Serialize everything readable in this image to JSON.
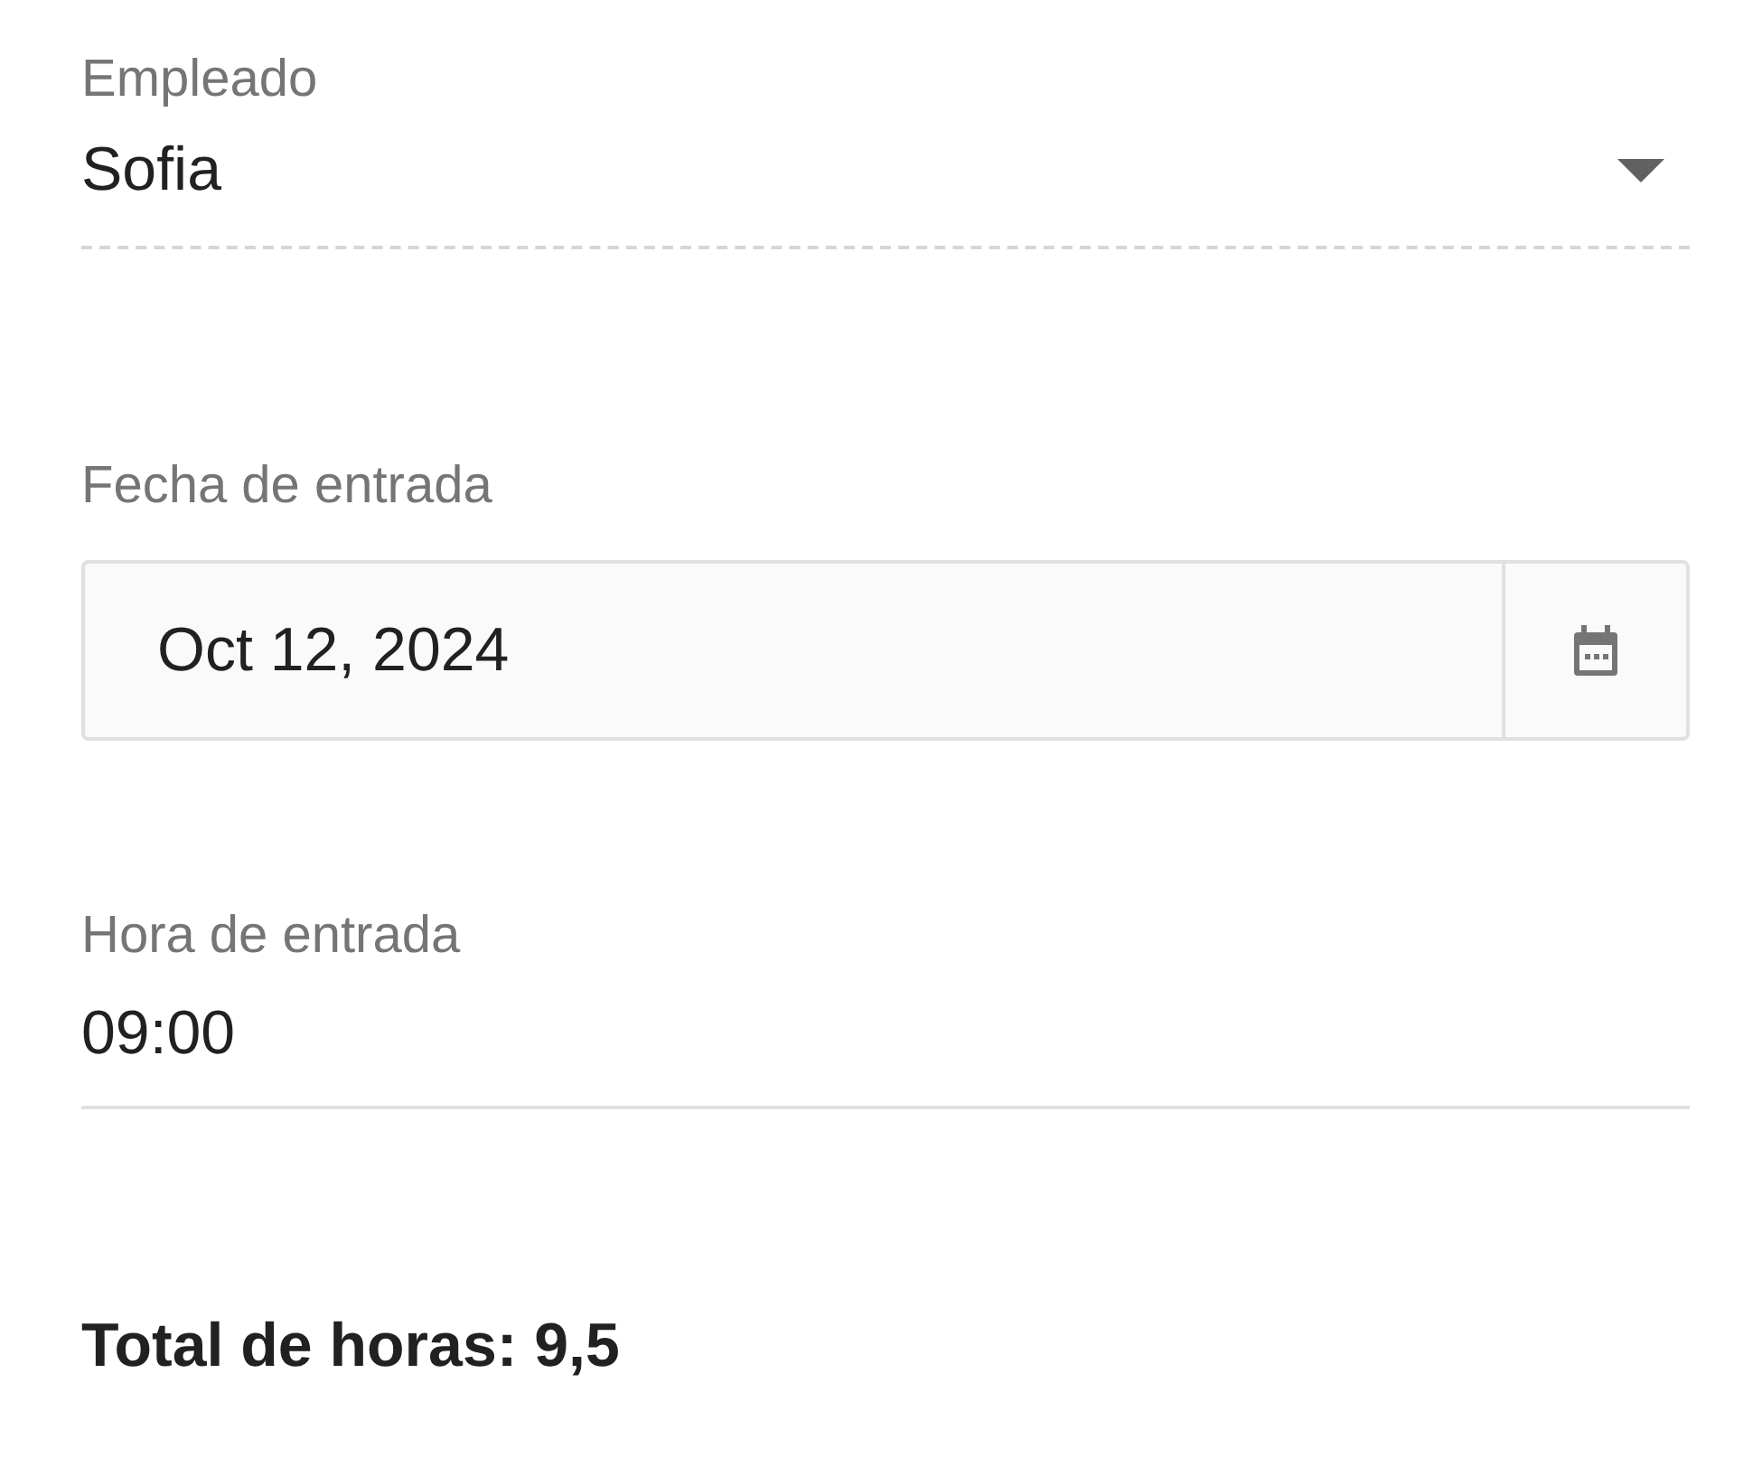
{
  "fields": [
    {
      "kind": "select",
      "label": "Empleado",
      "value": "Sofia"
    },
    {
      "kind": "date",
      "label": "Fecha de entrada",
      "value": "Oct 12, 2024"
    },
    {
      "kind": "time",
      "label": "Hora de entrada",
      "value": "09:00"
    }
  ],
  "total": "Total de horas: 9,5"
}
